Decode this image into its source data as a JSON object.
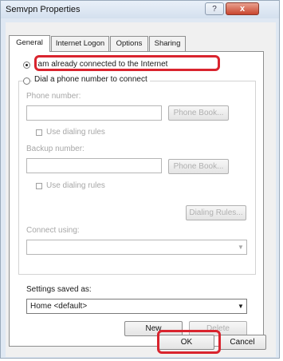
{
  "window": {
    "title": "Semvpn Properties",
    "help_glyph": "?",
    "close_glyph": "x"
  },
  "tabs": [
    "General",
    "Internet Logon",
    "Options",
    "Sharing"
  ],
  "general": {
    "radio_connected": "I am already connected to the Internet",
    "radio_dial": "Dial a phone number to connect",
    "phone_label": "Phone number:",
    "phone_book_btn": "Phone Book...",
    "use_dialing_rules_1": "Use dialing rules",
    "backup_label": "Backup number:",
    "phone_book_btn_2": "Phone Book...",
    "use_dialing_rules_2": "Use dialing rules",
    "dialing_rules_btn": "Dialing Rules...",
    "connect_using_label": "Connect using:",
    "settings_saved_label": "Settings saved as:",
    "settings_value": "Home <default>",
    "new_btn": "New",
    "delete_btn": "Delete"
  },
  "footer": {
    "ok": "OK",
    "cancel": "Cancel"
  },
  "colors": {
    "highlight": "#d9242e"
  }
}
